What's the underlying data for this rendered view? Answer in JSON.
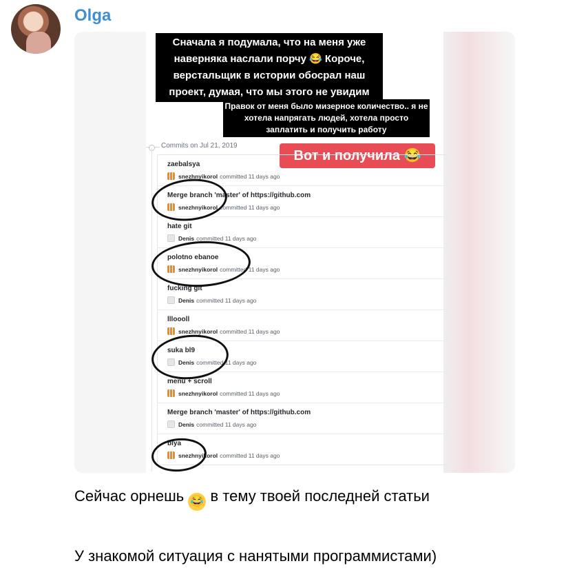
{
  "sender": "Olga",
  "image": {
    "bubble1": "Сначала я подумала, что на меня уже наверняка наслали порчу 😂 Короче, верстальщик в истории обосрал наш проект, думая, что мы этого не увидим",
    "bubble2": "Правок от меня было мизерное количество.. я не хотела напрягать людей, хотела просто заплатить и получить работу",
    "badge": "Вот и получила 😂",
    "commits_header": "Commits on Jul 21, 2019",
    "commits": [
      {
        "msg": "zaebalsya",
        "author": "snezhnyikorol",
        "when": "committed 11 days ago",
        "avatar": "orange"
      },
      {
        "msg": "Merge branch 'master' of https://github.com",
        "author": "snezhnyikorol",
        "when": "committed 11 days ago",
        "avatar": "orange"
      },
      {
        "msg": "hate git",
        "author": "Denis",
        "when": "committed 11 days ago",
        "avatar": "gray"
      },
      {
        "msg": "polotno ebanoe",
        "author": "snezhnyikorol",
        "when": "committed 11 days ago",
        "avatar": "orange"
      },
      {
        "msg": "fucking git",
        "author": "Denis",
        "when": "committed 11 days ago",
        "avatar": "gray"
      },
      {
        "msg": "llloooll",
        "author": "snezhnyikorol",
        "when": "committed 11 days ago",
        "avatar": "orange"
      },
      {
        "msg": "suka bl9",
        "author": "Denis",
        "when": "committed 11 days ago",
        "avatar": "gray"
      },
      {
        "msg": "menu + scroll",
        "author": "snezhnyikorol",
        "when": "committed 11 days ago",
        "avatar": "orange"
      },
      {
        "msg": "Merge branch 'master' of https://github.com",
        "author": "Denis",
        "when": "committed 11 days ago",
        "avatar": "gray"
      },
      {
        "msg": "blya",
        "author": "snezhnyikorol",
        "when": "committed 11 days ago",
        "avatar": "orange"
      }
    ]
  },
  "caption1_text_a": "Сейчас орнешь",
  "caption1_emoji": "😂",
  "caption1_text_b": "в тему твоей последней статьи",
  "caption2": "У знакомой ситуация с нанятыми программистами)"
}
